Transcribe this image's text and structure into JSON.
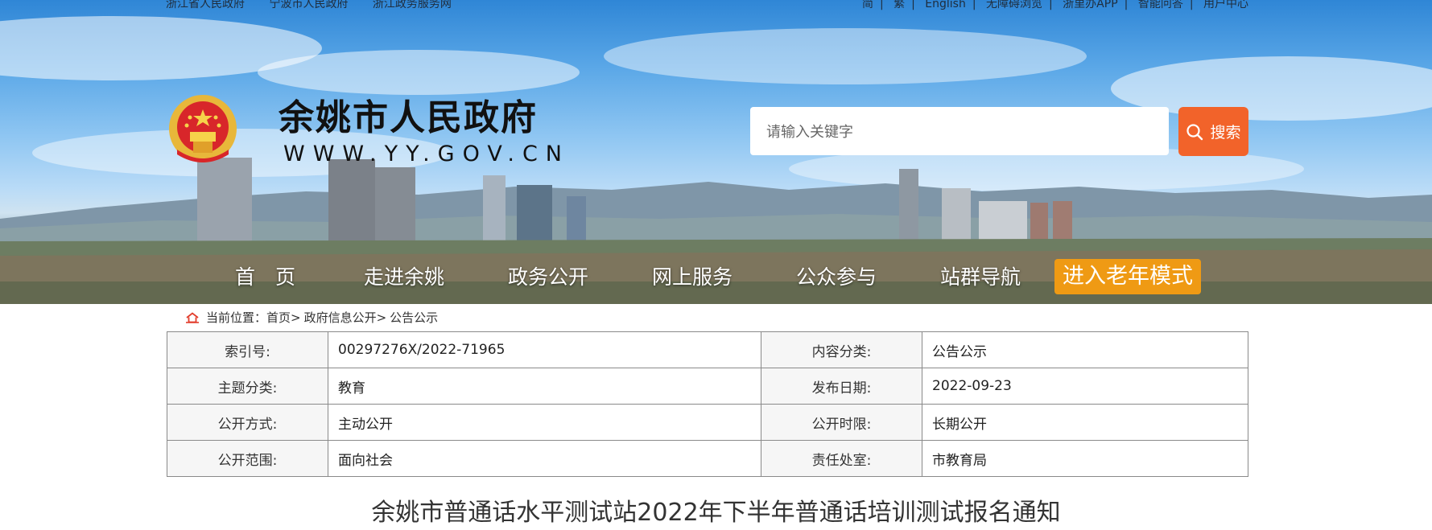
{
  "header": {
    "top_left_links": [
      "浙江省人民政府",
      "宁波市人民政府",
      "浙江政务服务网"
    ],
    "top_right_links": [
      "简",
      "繁",
      "English",
      "无障碍浏览",
      "浙里办APP",
      "智能问答",
      "用户中心"
    ],
    "site_title": "余姚市人民政府",
    "site_url": "WWW.YY.GOV.CN",
    "emblem_icon": "national-emblem-icon"
  },
  "search": {
    "placeholder": "请输入关键字",
    "button_label": "搜索"
  },
  "nav": {
    "items": [
      "首　页",
      "走进余姚",
      "政务公开",
      "网上服务",
      "公众参与",
      "站群导航"
    ],
    "elder_mode": "进入老年模式"
  },
  "breadcrumb": {
    "prefix": "当前位置：",
    "items": [
      "首页>",
      "政府信息公开>",
      "公告公示"
    ]
  },
  "meta": {
    "rows": [
      {
        "k1": "索引号:",
        "v1": "00297276X/2022-71965",
        "k2": "内容分类:",
        "v2": "公告公示"
      },
      {
        "k1": "主题分类:",
        "v1": "教育",
        "k2": "发布日期:",
        "v2": "2022-09-23"
      },
      {
        "k1": "公开方式:",
        "v1": "主动公开",
        "k2": "公开时限:",
        "v2": "长期公开"
      },
      {
        "k1": "公开范围:",
        "v1": "面向社会",
        "k2": "责任处室:",
        "v2": "市教育局"
      }
    ]
  },
  "article": {
    "title": "余姚市普通话水平测试站2022年下半年普通话培训测试报名通知"
  },
  "colors": {
    "search_button": "#f2632a",
    "elder_button": "#ef9a14",
    "table_border": "#8a8a8a"
  }
}
